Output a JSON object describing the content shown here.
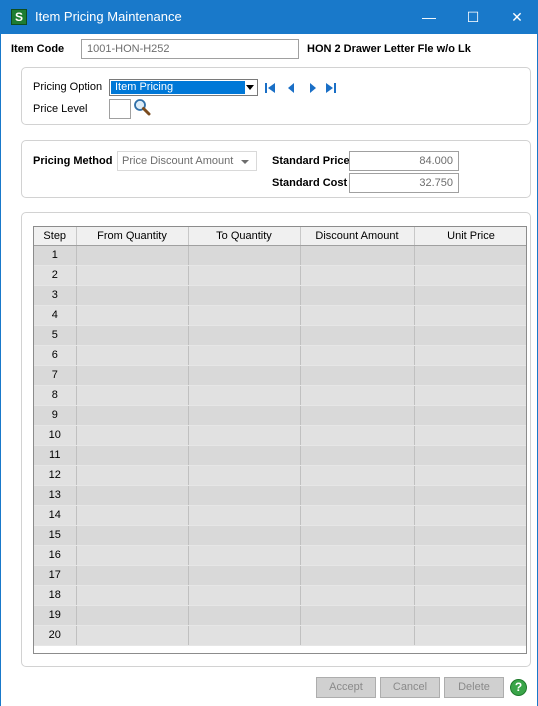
{
  "window": {
    "title": "Item Pricing Maintenance",
    "app_icon": "S",
    "controls": {
      "minimize": "—",
      "maximize": "☐",
      "close": "✕"
    }
  },
  "header": {
    "item_code_label": "Item Code",
    "item_code_value": "1001-HON-H252",
    "item_description": "HON 2 Drawer Letter Fle w/o Lk"
  },
  "options": {
    "pricing_option_label": "Pricing Option",
    "pricing_option_value": "Item Pricing",
    "price_level_label": "Price Level",
    "price_level_value": ""
  },
  "pricing": {
    "method_label": "Pricing Method",
    "method_value": "Price Discount Amount",
    "standard_price_label": "Standard Price",
    "standard_price_value": "84.000",
    "standard_cost_label": "Standard Cost",
    "standard_cost_value": "32.750"
  },
  "grid": {
    "columns": [
      "Step",
      "From Quantity",
      "To Quantity",
      "Discount Amount",
      "Unit Price"
    ],
    "steps": [
      "1",
      "2",
      "3",
      "4",
      "5",
      "6",
      "7",
      "8",
      "9",
      "10",
      "11",
      "12",
      "13",
      "14",
      "15",
      "16",
      "17",
      "18",
      "19",
      "20"
    ]
  },
  "footer": {
    "accept_label": "Accept",
    "cancel_label": "Cancel",
    "delete_label": "Delete",
    "help_label": "?"
  },
  "colors": {
    "titlebar": "#1979ca",
    "selection": "#0078d7",
    "nav_arrows": "#1a6fc6",
    "help": "#3aa549"
  },
  "icons": [
    "first-record-icon",
    "previous-record-icon",
    "next-record-icon",
    "last-record-icon",
    "lookup-magnifier-icon",
    "help-icon"
  ]
}
